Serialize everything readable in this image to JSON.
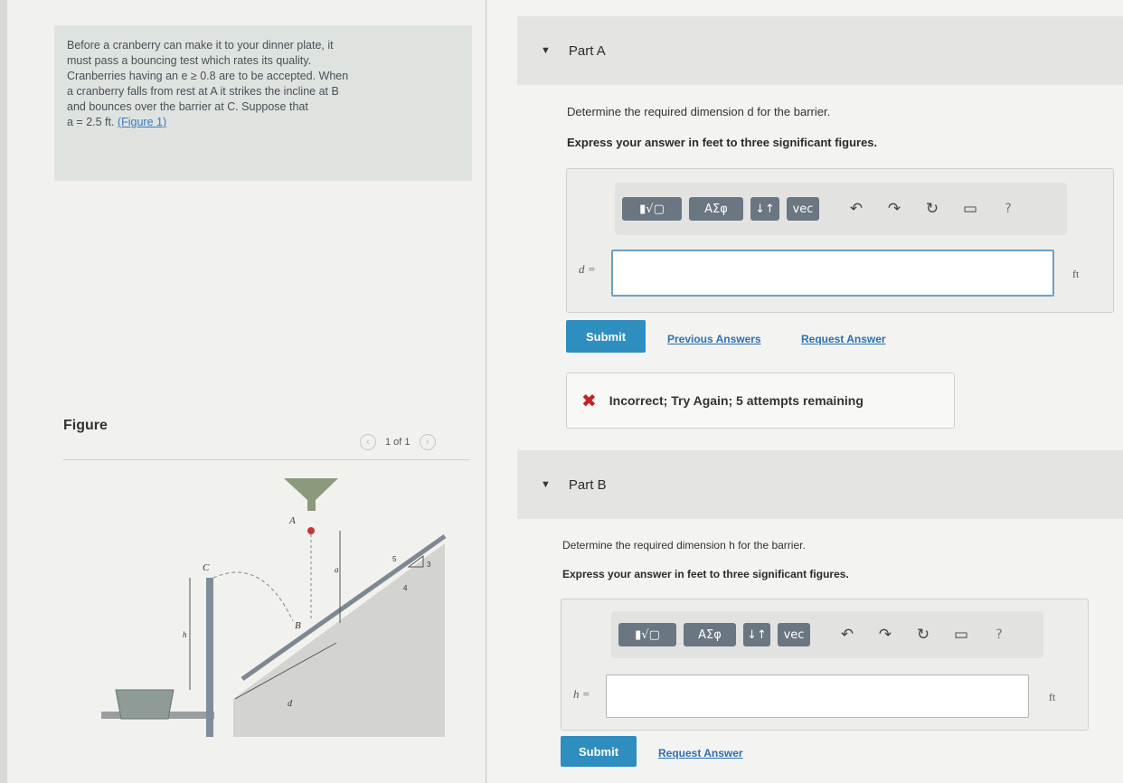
{
  "problem": {
    "line1": "Before a cranberry can make it to your dinner plate, it",
    "line2": "must pass a bouncing test which rates its quality.",
    "line3": "Cranberries having an e ≥ 0.8 are to be accepted. When",
    "line4": "a cranberry falls from rest at A it strikes the incline at B",
    "line5": "and bounces over the barrier at C. Suppose that",
    "line6": "a = 2.5 ft. ",
    "figure_link": "(Figure 1)"
  },
  "figure": {
    "heading": "Figure",
    "pager_text": "1 of 1",
    "prev_icon": "chevron-left-icon",
    "next_icon": "chevron-right-icon",
    "labels": {
      "A": "A",
      "B": "B",
      "C": "C",
      "a": "a",
      "h": "h",
      "d": "d",
      "slope_rise": "3",
      "slope_hyp": "5",
      "slope_run": "4"
    }
  },
  "part_a": {
    "title": "Part A",
    "question": "Determine the required dimension d for the barrier.",
    "instruction": "Express your answer in feet to three significant figures.",
    "toolbar": {
      "templates_label": "▮√▢",
      "greek_label": "ΑΣφ",
      "arrows_label": "↓↑",
      "vec_label": "vec",
      "undo_icon": "↶",
      "redo_icon": "↷",
      "reset_icon": "↻",
      "keyboard_icon": "▭",
      "help_icon": "?"
    },
    "answer_label": "d =",
    "answer_value": "",
    "unit": "ft",
    "submit_label": "Submit",
    "previous_answers_label": "Previous Answers",
    "request_answer_label": "Request Answer",
    "feedback_icon": "✖",
    "feedback_text": "Incorrect; Try Again; 5 attempts remaining"
  },
  "part_b": {
    "title": "Part B",
    "question": "Determine the required dimension h for the barrier.",
    "instruction": "Express your answer in feet to three significant figures.",
    "toolbar": {
      "templates_label": "▮√▢",
      "greek_label": "ΑΣφ",
      "arrows_label": "↓↑",
      "vec_label": "vec",
      "undo_icon": "↶",
      "redo_icon": "↷",
      "reset_icon": "↻",
      "keyboard_icon": "▭",
      "help_icon": "?"
    },
    "answer_label": "h =",
    "answer_value": "",
    "unit": "ft",
    "submit_label": "Submit",
    "request_answer_label": "Request Answer"
  },
  "colors": {
    "accent": "#2e8ec0",
    "link": "#2c70b5",
    "error": "#c4221f",
    "toolbar_btn": "#6a7681"
  }
}
